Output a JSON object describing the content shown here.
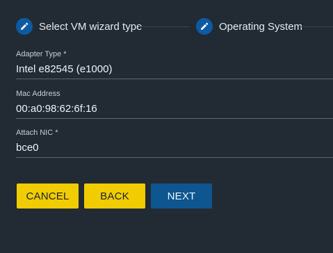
{
  "stepper": {
    "steps": [
      {
        "label": "Select VM wizard type",
        "icon": "pencil-icon"
      },
      {
        "label": "Operating System",
        "icon": "pencil-icon"
      }
    ]
  },
  "form": {
    "adapter_type": {
      "label": "Adapter Type *",
      "value": "Intel e82545 (e1000)"
    },
    "mac_address": {
      "label": "Mac Address",
      "value": "00:a0:98:62:6f:16"
    },
    "attach_nic": {
      "label": "Attach NIC *",
      "value": "bce0"
    }
  },
  "actions": {
    "cancel_label": "CANCEL",
    "back_label": "BACK",
    "next_label": "NEXT"
  },
  "colors": {
    "background": "#222b34",
    "step_icon": "#0c5aa3",
    "secondary_button": "#f0cc00",
    "primary_button": "#0e5690"
  }
}
